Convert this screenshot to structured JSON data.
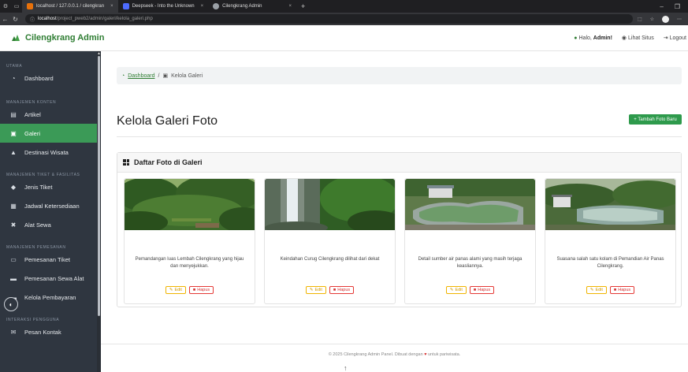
{
  "browser": {
    "tabs": [
      {
        "title": "localhost / 127.0.0.1 / cilengkran",
        "color": "#e8710a",
        "active": true
      },
      {
        "title": "Deepseek - Into the Unknown",
        "color": "#4d6bfe",
        "active": false
      },
      {
        "title": "Cilengkrang Admin",
        "color": "#9aa0a6",
        "active": false
      }
    ],
    "url_host": "localhost",
    "url_path": "/project_pweb2/admin/galeri/kelola_galeri.php"
  },
  "navbar": {
    "brand": "Cilengkrang Admin",
    "greeting_prefix": "Halo,",
    "greeting_user": "Admin!",
    "view_site": "Lihat Situs",
    "logout": "Logout"
  },
  "sidebar": {
    "sections": [
      {
        "title": "UTAMA",
        "items": [
          {
            "label": "Dashboard",
            "icon": "gauge-icon"
          }
        ]
      },
      {
        "title": "MANAJEMEN KONTEN",
        "items": [
          {
            "label": "Artikel",
            "icon": "newspaper-icon"
          },
          {
            "label": "Galeri",
            "icon": "images-icon",
            "active": true
          },
          {
            "label": "Destinasi Wisata",
            "icon": "map-icon"
          }
        ]
      },
      {
        "title": "MANAJEMEN TIKET & FASILITAS",
        "items": [
          {
            "label": "Jenis Tiket",
            "icon": "ticket-icon"
          },
          {
            "label": "Jadwal Ketersediaan",
            "icon": "calendar-icon"
          },
          {
            "label": "Alat Sewa",
            "icon": "tools-icon"
          }
        ]
      },
      {
        "title": "MANAJEMEN PEMESANAN",
        "items": [
          {
            "label": "Pemesanan Tiket",
            "icon": "receipt-icon"
          },
          {
            "label": "Pemesanan Sewa Alat",
            "icon": "truck-icon"
          },
          {
            "label": "Kelola Pembayaran",
            "icon": "card-icon"
          }
        ]
      },
      {
        "title": "INTERAKSI PENGGUNA",
        "items": [
          {
            "label": "Pesan Kontak",
            "icon": "envelope-icon"
          }
        ]
      }
    ]
  },
  "breadcrumb": {
    "home": "Dashboard",
    "separator": "/",
    "current": "Kelola Galeri"
  },
  "page": {
    "title": "Kelola Galeri Foto",
    "add_button": "+ Tambah Foto Baru"
  },
  "gallery": {
    "heading": "Daftar Foto di Galeri",
    "edit_label": "Edit",
    "delete_label": "Hapus",
    "photos": [
      {
        "caption": "Pemandangan luas Lembah Cilengkrang yang hijau dan menyejukkan.",
        "scene": "forest-valley"
      },
      {
        "caption": "Keindahan Curug Cilengkrang dilihat dari dekat",
        "scene": "waterfall"
      },
      {
        "caption": "Detail sumber air panas alami yang masih terjaga keasliannya.",
        "scene": "hot-spring-pool"
      },
      {
        "caption": "Suasana salah satu kolam di Pemandian Air Panas Cilengkrang.",
        "scene": "hot-spring-pond"
      }
    ]
  },
  "footer": {
    "text_before": "© 2025 Cilengkrang Admin Panel. Dibuat dengan",
    "text_after": "untuk pariwisata."
  },
  "colors": {
    "sidebar_bg": "#2f3640",
    "accent": "#3b9a57",
    "brand": "#2e7d32",
    "danger": "#e53935",
    "warning": "#f0b400"
  }
}
